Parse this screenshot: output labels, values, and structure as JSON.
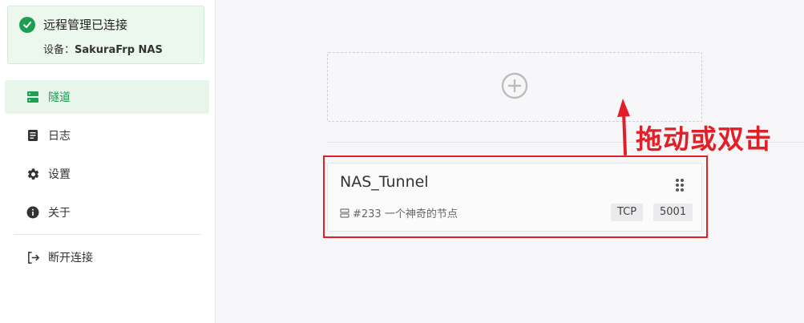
{
  "status": {
    "title": "远程管理已连接",
    "device_label": "设备：",
    "device_name": "SakuraFrp NAS"
  },
  "nav": {
    "items": [
      {
        "label": "隧道",
        "icon": "server-icon",
        "active": true
      },
      {
        "label": "日志",
        "icon": "log-icon",
        "active": false
      },
      {
        "label": "设置",
        "icon": "gear-icon",
        "active": false
      },
      {
        "label": "关于",
        "icon": "info-icon",
        "active": false
      }
    ],
    "disconnect": {
      "label": "断开连接",
      "icon": "logout-icon"
    }
  },
  "add_zone": {
    "icon": "plus-circle-icon"
  },
  "tunnel": {
    "name": "NAS_Tunnel",
    "node": "#233 一个神奇的节点",
    "protocol": "TCP",
    "port": "5001"
  },
  "annotation": {
    "text": "拖动或双击",
    "color": "#e21f26"
  },
  "colors": {
    "accent": "#1e9e52",
    "annotation": "#e21f26"
  }
}
